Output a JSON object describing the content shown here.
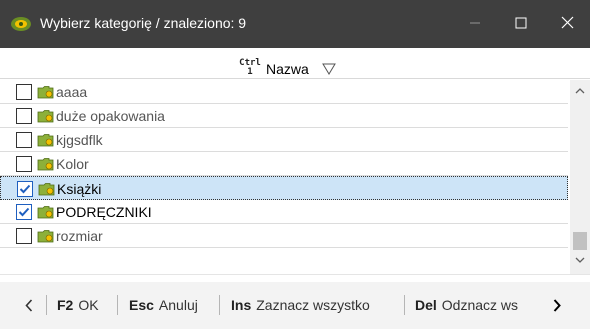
{
  "window": {
    "title": "Wybierz kategorię / znaleziono: 9",
    "icon": "app-logo-icon",
    "controls": [
      "minimize-icon",
      "maximize-icon",
      "close-icon"
    ],
    "titlebar_color": "#3f3f3f"
  },
  "header": {
    "ctrl_hint_top": "Ctrl",
    "ctrl_hint_bottom": "1",
    "column_title": "Nazwa",
    "sort_icon": "sort-triangle-icon"
  },
  "list": {
    "selected_color": "#cde4f7",
    "items": [
      {
        "label": "aaaa",
        "checked": false,
        "selected": false
      },
      {
        "label": "duże opakowania",
        "checked": false,
        "selected": false
      },
      {
        "label": "kjgsdflk",
        "checked": false,
        "selected": false
      },
      {
        "label": "Kolor",
        "checked": false,
        "selected": false
      },
      {
        "label": "Książki",
        "checked": true,
        "selected": true
      },
      {
        "label": "PODRĘCZNIKI",
        "checked": true,
        "selected": false
      },
      {
        "label": "rozmiar",
        "checked": false,
        "selected": false
      }
    ]
  },
  "toolbar": {
    "prev_icon": "chevron-left-icon",
    "next_icon": "chevron-right-icon",
    "ok": {
      "key": "F2",
      "label": "OK"
    },
    "cancel": {
      "key": "Esc",
      "label": "Anuluj"
    },
    "select_all": {
      "key": "Ins",
      "label": "Zaznacz wszystko"
    },
    "deselect_all": {
      "key": "Del",
      "label": "Odznacz ws"
    }
  }
}
